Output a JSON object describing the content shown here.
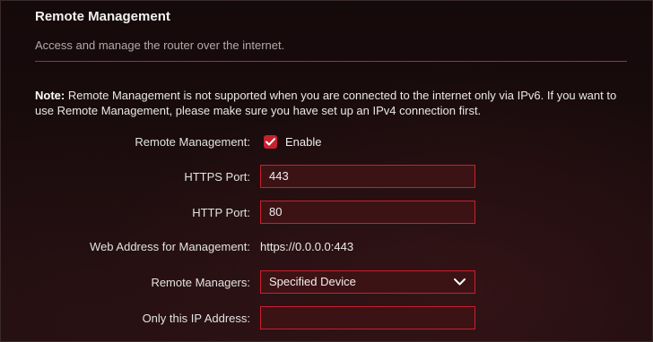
{
  "section": {
    "title": "Remote Management",
    "subtitle": "Access and manage the router over the internet."
  },
  "note": {
    "prefix": "Note:",
    "text": " Remote Management is not supported when you are connected to the internet only via IPv6. If you want to use Remote Management, please make sure you have set up an IPv4 connection first."
  },
  "form": {
    "remote_management": {
      "label": "Remote Management:",
      "checkbox_label": "Enable",
      "checked": true
    },
    "https_port": {
      "label": "HTTPS Port:",
      "value": "443"
    },
    "http_port": {
      "label": "HTTP Port:",
      "value": "80"
    },
    "web_address": {
      "label": "Web Address for Management:",
      "value": "https://0.0.0.0:443"
    },
    "remote_managers": {
      "label": "Remote Managers:",
      "selected": "Specified Device"
    },
    "ip_address": {
      "label": "Only this IP Address:",
      "value": ""
    }
  },
  "icons": {
    "checkbox": "check-icon",
    "dropdown": "chevron-down-icon"
  },
  "colors": {
    "accent": "#c9202f",
    "field_bg": "#3c1315",
    "background": "#1a0c0d"
  }
}
